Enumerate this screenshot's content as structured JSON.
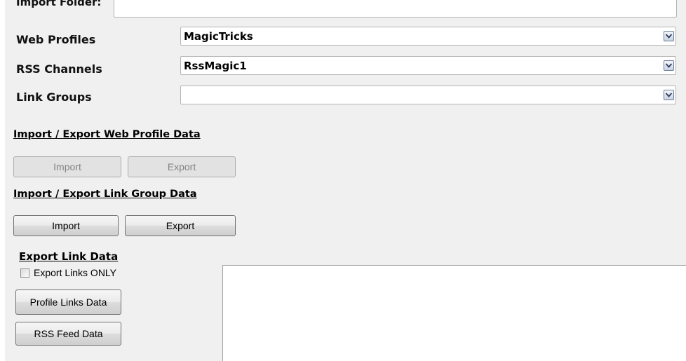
{
  "import_folder": {
    "label": "Import Folder:",
    "value": ""
  },
  "web_profiles": {
    "label": "Web Profiles",
    "value": "MagicTricks"
  },
  "rss_channels": {
    "label": "RSS Channels",
    "value": "RssMagic1"
  },
  "link_groups": {
    "label": "Link Groups",
    "value": ""
  },
  "web_profile_data": {
    "heading": "Import / Export Web Profile Data",
    "import_label": "Import",
    "export_label": "Export"
  },
  "link_group_data": {
    "heading": "Import / Export Link Group Data",
    "import_label": "Import",
    "export_label": "Export"
  },
  "export_link_data": {
    "heading": "Export Link Data",
    "checkbox_label": "Export Links ONLY",
    "checkbox_checked": false,
    "profile_links_label": "Profile Links Data",
    "rss_feed_label": "RSS Feed Data"
  },
  "output": {
    "text": ""
  }
}
